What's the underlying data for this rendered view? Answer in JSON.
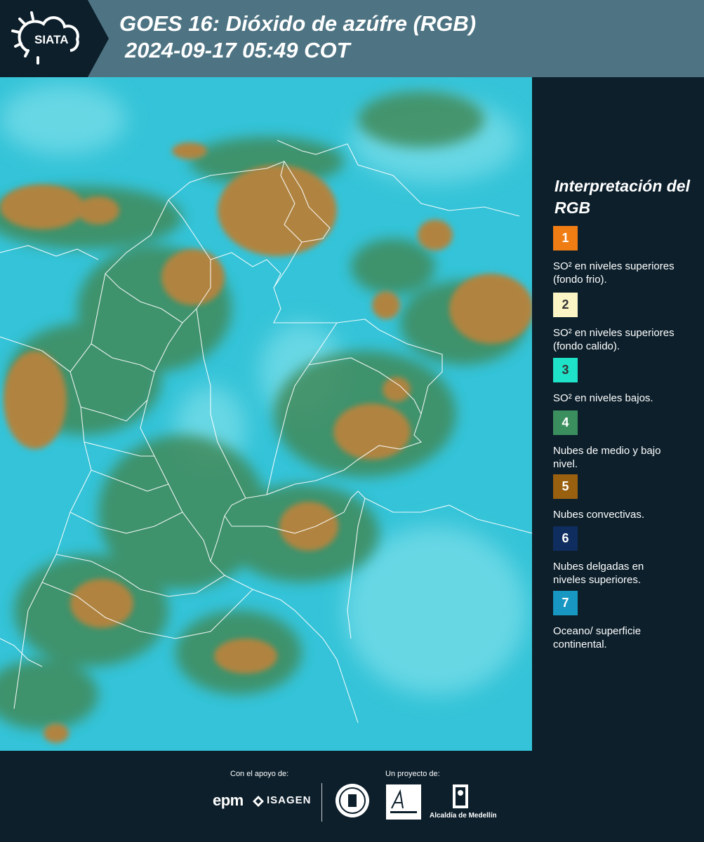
{
  "header": {
    "logo_text": "SIATA",
    "title_line1": "GOES 16: Dióxido de azúfre (RGB)",
    "title_line2": "2024-09-17 05:49 COT",
    "background_color": "#4e7483"
  },
  "map": {
    "ocean_color": "#34c3d8",
    "green_cloud_color": "#3f8a5a",
    "convective_color": "#b08440",
    "border_color": "#ffffff"
  },
  "legend": {
    "title": "Interpretación del RGB",
    "items": [
      {
        "number": "1",
        "label": "SO² en niveles superiores (fondo frio).",
        "color": "#f07d14"
      },
      {
        "number": "2",
        "label": "SO² en niveles superiores (fondo calido).",
        "color": "#fbf4c4"
      },
      {
        "number": "3",
        "label": "SO² en niveles bajos.",
        "color": "#1fe3c8"
      },
      {
        "number": "4",
        "label": "Nubes de medio y bajo nivel.",
        "color": "#3b8f5f"
      },
      {
        "number": "5",
        "label": "Nubes convectivas.",
        "color": "#996010"
      },
      {
        "number": "6",
        "label": "Nubes delgadas en niveles superiores.",
        "color": "#0f2d5e"
      },
      {
        "number": "7",
        "label": "Oceano/ superficie continental.",
        "color": "#1797c1"
      }
    ]
  },
  "footer": {
    "support_label": "Con el apoyo de:",
    "project_label": "Un proyecto de:",
    "epm_text": "epm",
    "isagen_text": "ISAGEN",
    "alcaldia_text": "Alcaldía de Medellín"
  }
}
